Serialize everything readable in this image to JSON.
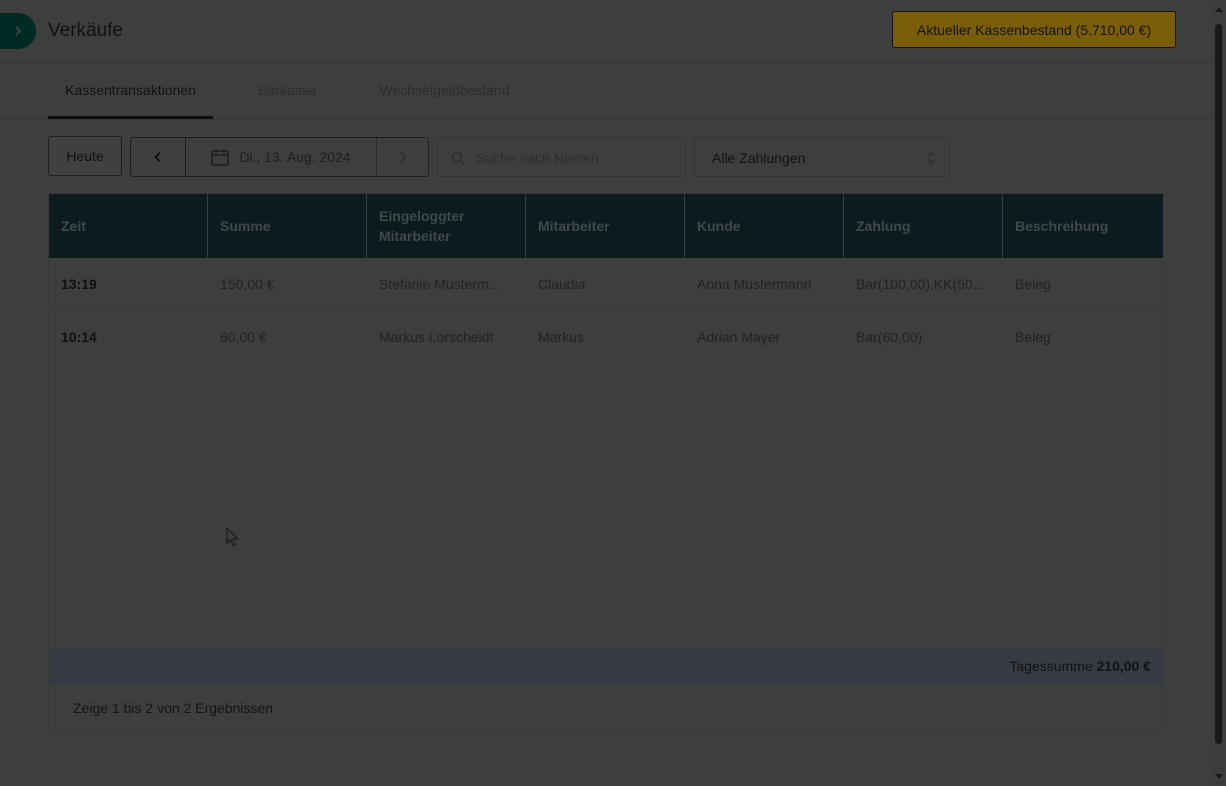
{
  "header": {
    "title": "Verkäufe",
    "cash_button_label": "Aktueller Kassenbestand (5.710,00 €)"
  },
  "tabs": [
    {
      "label": "Kassentransaktionen",
      "active": true
    },
    {
      "label": "Barkasse",
      "active": false
    },
    {
      "label": "Wechselgeldbestand",
      "active": false
    }
  ],
  "toolbar": {
    "today_label": "Heute",
    "date_label": "Di., 13. Aug. 2024",
    "search_placeholder": "Suche nach Namen",
    "payment_filter": "Alle Zahlungen"
  },
  "table": {
    "columns": [
      "Zeit",
      "Summe",
      "Eingeloggter Mitarbeiter",
      "Mitarbeiter",
      "Kunde",
      "Zahlung",
      "Beschreibung"
    ],
    "rows": [
      {
        "zeit": "13:19",
        "summe": "150,00 €",
        "eingeloggt": "Stefanie Musterm...",
        "mitarbeiter": "Claudia",
        "kunde": "Anna Mustermann",
        "zahlung": "Bar(100,00),KK(50...",
        "beschreibung": "Beleg"
      },
      {
        "zeit": "10:14",
        "summe": "60,00 €",
        "eingeloggt": "Markus Lorscheidt",
        "mitarbeiter": "Markus",
        "kunde": "Adrian Mayer",
        "zahlung": "Bar(60,00)",
        "beschreibung": "Beleg"
      }
    ],
    "total_label": "Tagessumme",
    "total_value": "210,00 €"
  },
  "pagination": {
    "prefix": "Zeige",
    "from": "1",
    "word_to": "bis",
    "to": "2",
    "word_of": "von",
    "total": "2",
    "suffix": "Ergebnissen"
  },
  "colors": {
    "accent": "#022a24",
    "cash_button": "#7a5d09",
    "table_header": "#0d1b1f"
  }
}
